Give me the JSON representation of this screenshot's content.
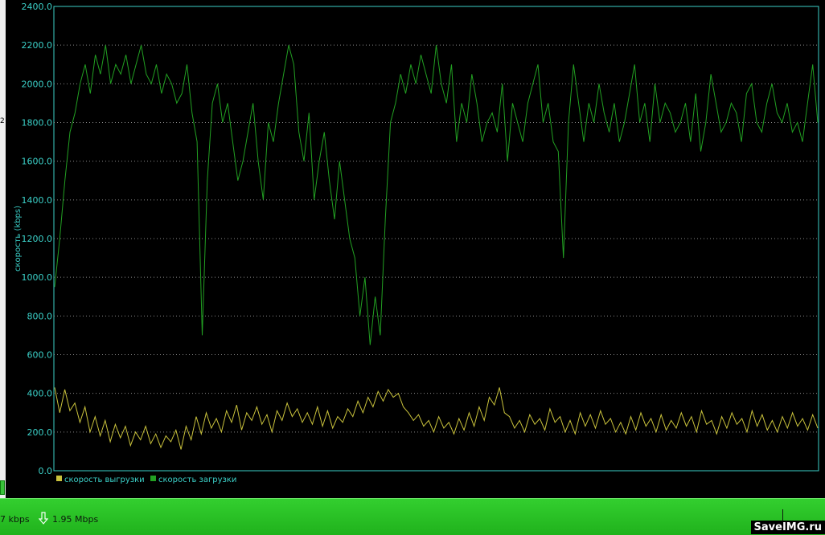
{
  "window": {
    "left_edge_char": "2",
    "upload_status": "7 kbps",
    "download_status": "1.95 Mbps",
    "watermark": "SaveIMG.ru"
  },
  "colors": {
    "download": "#22a022",
    "upload": "#c9c23c",
    "axis_text": "#3bd0c8",
    "grid": "#8a8a8a",
    "status_bar": "#2ac326"
  },
  "chart_data": {
    "type": "line",
    "xlabel": "",
    "ylabel": "скорость (kbps)",
    "ylim": [
      0,
      2400
    ],
    "yticks": [
      "0.0",
      "200.0",
      "400.0",
      "600.0",
      "800.0",
      "1000.0",
      "1200.0",
      "1400.0",
      "1600.0",
      "1800.0",
      "2000.0",
      "2200.0",
      "2400.0"
    ],
    "grid": "horizontal dotted",
    "legend_position": "bottom-left",
    "series": [
      {
        "name": "скорость выгрузки",
        "color": "#c9c23c",
        "values": [
          430,
          300,
          420,
          310,
          350,
          250,
          330,
          200,
          280,
          180,
          260,
          150,
          240,
          170,
          230,
          130,
          200,
          160,
          230,
          140,
          190,
          120,
          180,
          150,
          210,
          110,
          230,
          160,
          280,
          190,
          300,
          220,
          270,
          200,
          310,
          250,
          340,
          210,
          300,
          260,
          330,
          240,
          290,
          200,
          310,
          260,
          350,
          280,
          320,
          250,
          300,
          240,
          330,
          230,
          310,
          220,
          280,
          250,
          320,
          280,
          360,
          300,
          380,
          330,
          410,
          360,
          420,
          380,
          400,
          330,
          300,
          260,
          290,
          230,
          260,
          200,
          280,
          220,
          250,
          190,
          270,
          210,
          300,
          230,
          330,
          260,
          380,
          340,
          430,
          300,
          280,
          220,
          260,
          200,
          290,
          240,
          270,
          210,
          320,
          250,
          280,
          200,
          260,
          190,
          300,
          230,
          290,
          220,
          310,
          240,
          270,
          200,
          250,
          190,
          280,
          210,
          300,
          230,
          270,
          200,
          290,
          210,
          260,
          220,
          300,
          230,
          280,
          200,
          310,
          240,
          260,
          190,
          280,
          220,
          300,
          240,
          270,
          200,
          310,
          230,
          290,
          210,
          260,
          200,
          280,
          220,
          300,
          230,
          270,
          210,
          290,
          220
        ]
      },
      {
        "name": "скорость загрузки",
        "color": "#22a022",
        "values": [
          950,
          1200,
          1500,
          1750,
          1850,
          2000,
          2100,
          1950,
          2150,
          2050,
          2200,
          2000,
          2100,
          2050,
          2150,
          2000,
          2100,
          2200,
          2050,
          2000,
          2100,
          1950,
          2050,
          2000,
          1900,
          1950,
          2100,
          1850,
          1700,
          700,
          1500,
          1900,
          2000,
          1800,
          1900,
          1700,
          1500,
          1600,
          1750,
          1900,
          1600,
          1400,
          1800,
          1700,
          1900,
          2050,
          2200,
          2100,
          1750,
          1600,
          1850,
          1400,
          1600,
          1750,
          1500,
          1300,
          1600,
          1400,
          1200,
          1100,
          800,
          1000,
          650,
          900,
          700,
          1300,
          1800,
          1900,
          2050,
          1950,
          2100,
          2000,
          2150,
          2050,
          1950,
          2200,
          2000,
          1900,
          2100,
          1700,
          1900,
          1800,
          2050,
          1900,
          1700,
          1800,
          1850,
          1750,
          2000,
          1600,
          1900,
          1800,
          1700,
          1900,
          2000,
          2100,
          1800,
          1900,
          1700,
          1650,
          1100,
          1800,
          2100,
          1900,
          1700,
          1900,
          1800,
          2000,
          1850,
          1750,
          1900,
          1700,
          1800,
          1950,
          2100,
          1800,
          1900,
          1700,
          2000,
          1800,
          1900,
          1850,
          1750,
          1800,
          1900,
          1700,
          1950,
          1650,
          1800,
          2050,
          1900,
          1750,
          1800,
          1900,
          1850,
          1700,
          1950,
          2000,
          1800,
          1750,
          1900,
          2000,
          1850,
          1800,
          1900,
          1750,
          1800,
          1700,
          1900,
          2100,
          1800
        ]
      }
    ]
  }
}
